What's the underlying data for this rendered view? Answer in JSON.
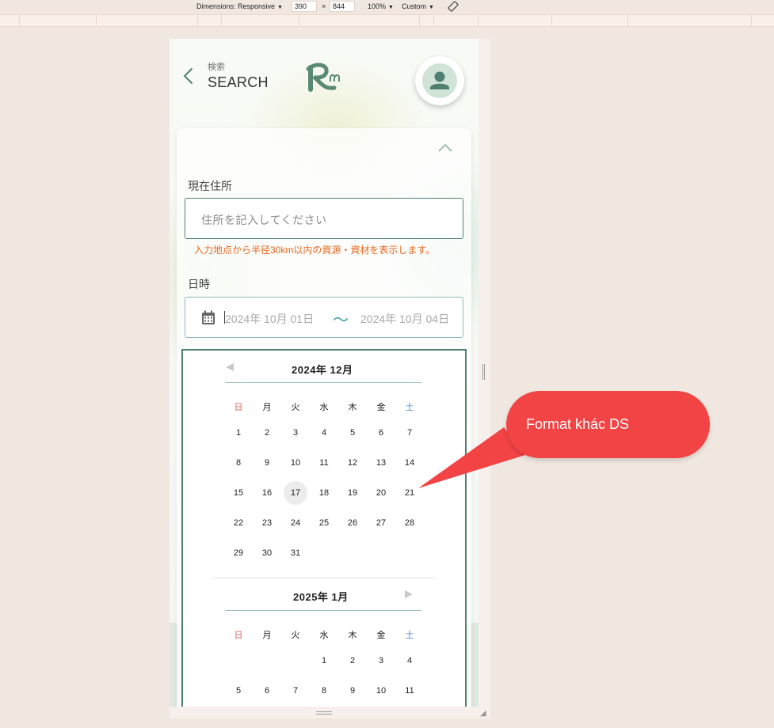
{
  "devtools": {
    "dimensions_label": "Dimensions: Responsive",
    "width": "390",
    "times": "×",
    "height": "844",
    "zoom": "100%",
    "throttle": "Custom"
  },
  "header": {
    "subtitle": "検索",
    "title": "SEARCH"
  },
  "form": {
    "address_label": "現在住所",
    "address_placeholder": "住所を記入してください",
    "address_note": "入力地点から半径30km以内の資源・資材を表示します。",
    "datetime_label": "日時",
    "date_start": "2024年 10月 01日",
    "date_separator": "〜",
    "date_end": "2024年 10月 04日"
  },
  "calendar": {
    "weekdays": [
      "日",
      "月",
      "火",
      "水",
      "木",
      "金",
      "土"
    ],
    "month1": {
      "title": "2024年  12月",
      "rows": [
        [
          "1",
          "2",
          "3",
          "4",
          "5",
          "6",
          "7"
        ],
        [
          "8",
          "9",
          "10",
          "11",
          "12",
          "13",
          "14"
        ],
        [
          "15",
          "16",
          "17",
          "18",
          "19",
          "20",
          "21"
        ],
        [
          "22",
          "23",
          "24",
          "25",
          "26",
          "27",
          "28"
        ],
        [
          "29",
          "30",
          "31",
          "",
          "",
          "",
          ""
        ]
      ],
      "today": "17"
    },
    "month2": {
      "title": "2025年  1月",
      "rows": [
        [
          "",
          "",
          "",
          "1",
          "2",
          "3",
          "4"
        ],
        [
          "5",
          "6",
          "7",
          "8",
          "9",
          "10",
          "11"
        ]
      ]
    }
  },
  "annotation": {
    "text": "Format khác DS",
    "color": "#f24345"
  },
  "colors": {
    "accent": "#4f7f70",
    "warning": "#e8671f",
    "sunday": "#e35f5f",
    "saturday": "#4f7fd8"
  }
}
